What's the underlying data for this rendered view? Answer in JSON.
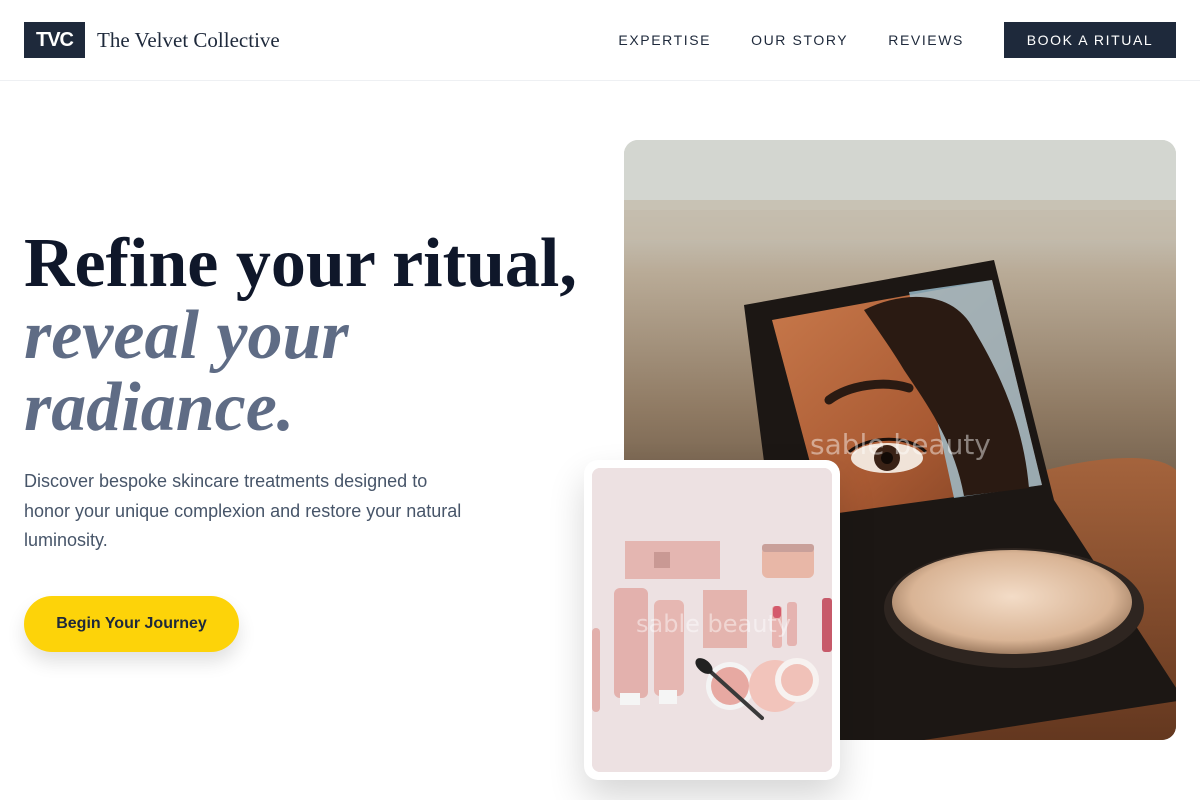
{
  "brand": {
    "logo": "TVC",
    "name": "The Velvet Collective"
  },
  "nav": {
    "links": [
      "EXPERTISE",
      "OUR STORY",
      "REVIEWS"
    ],
    "cta": "BOOK A RITUAL"
  },
  "hero": {
    "headline_line1": "Refine your ritual,",
    "headline_line2": "reveal your",
    "headline_line3": "radiance.",
    "subtext": "Discover bespoke skincare treatments designed to honor your unique complexion and restore your natural luminosity.",
    "cta": "Begin Your Journey"
  },
  "images": {
    "main_watermark": "sable beauty",
    "product_watermark": "sable beauty"
  },
  "colors": {
    "primary": "#1e293b",
    "accent": "#fdd309",
    "headline_italic": "#5f6c85"
  }
}
